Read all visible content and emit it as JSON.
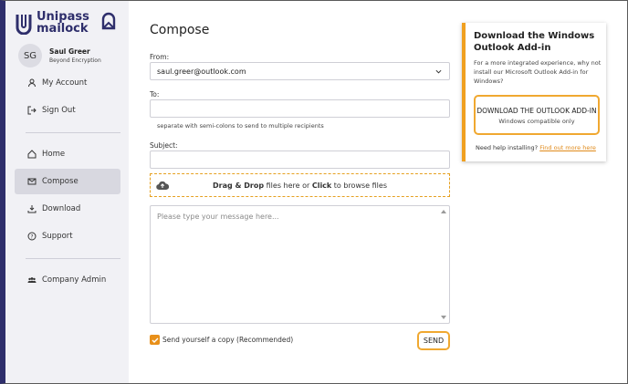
{
  "brand": {
    "name_line1": "Unipass",
    "name_line2": "mailock"
  },
  "user": {
    "initials": "SG",
    "name": "Saul Greer",
    "subtitle": "Beyond Encryption"
  },
  "nav": {
    "my_account": "My Account",
    "sign_out": "Sign Out",
    "home": "Home",
    "compose": "Compose",
    "download": "Download",
    "support": "Support",
    "company_admin": "Company Admin"
  },
  "compose": {
    "title": "Compose",
    "from_label": "From:",
    "from_value": "saul.greer@outlook.com",
    "to_label": "To:",
    "to_value": "",
    "to_hint": "separate with semi-colons to send to multiple recipients",
    "subject_label": "Subject:",
    "subject_value": "",
    "drop_bold1": "Drag & Drop",
    "drop_text1": " files here or ",
    "drop_bold2": "Click",
    "drop_text2": " to browse files",
    "message_placeholder": "Please type your message here...",
    "copy_label": "Send yourself a copy (Recommended)",
    "copy_checked": true,
    "send_label": "SEND"
  },
  "addin": {
    "title": "Download the Windows Outlook Add-in",
    "text": "For a more integrated experience, why not install our Microsoft Outlook Add-in for Windows?",
    "button_main": "DOWNLOAD THE OUTLOOK ADD-IN",
    "button_sub": "Windows compatible only",
    "help_text": "Need help installing? ",
    "help_link": "Find out more here"
  },
  "colors": {
    "accent": "#f0a020",
    "brand": "#2e2e6b",
    "sidebar_bg": "#f1f1f5"
  }
}
